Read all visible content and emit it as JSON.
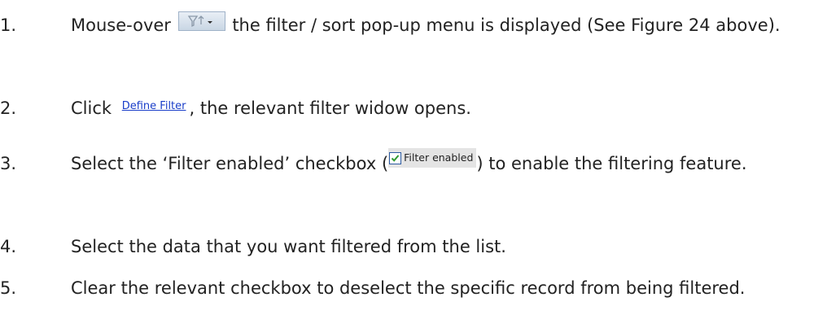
{
  "steps": [
    {
      "number": "1.",
      "before_icon": "Mouse-over",
      "icon": "filter-sort-button-icon",
      "after_icon": " the filter / sort pop-up menu is displayed (See Figure 24 above)."
    },
    {
      "number": "2.",
      "before_link": "Click",
      "link": "Define Filter",
      "after_link": ", the relevant filter widow opens."
    },
    {
      "number": "3.",
      "before_checkbox": "Select the ‘Filter enabled’ checkbox (",
      "checkbox_label": "Filter enabled",
      "after_checkbox": ") to enable the filtering feature."
    },
    {
      "number": "4.",
      "text": "Select the data that you want filtered from the list."
    },
    {
      "number": "5.",
      "text": "Clear the relevant checkbox to deselect the specific record from being filtered."
    }
  ],
  "colors": {
    "link": "#1a3ec9",
    "checkbox_background": "#e4e4e4",
    "checkmark": "#2f9b2f"
  }
}
